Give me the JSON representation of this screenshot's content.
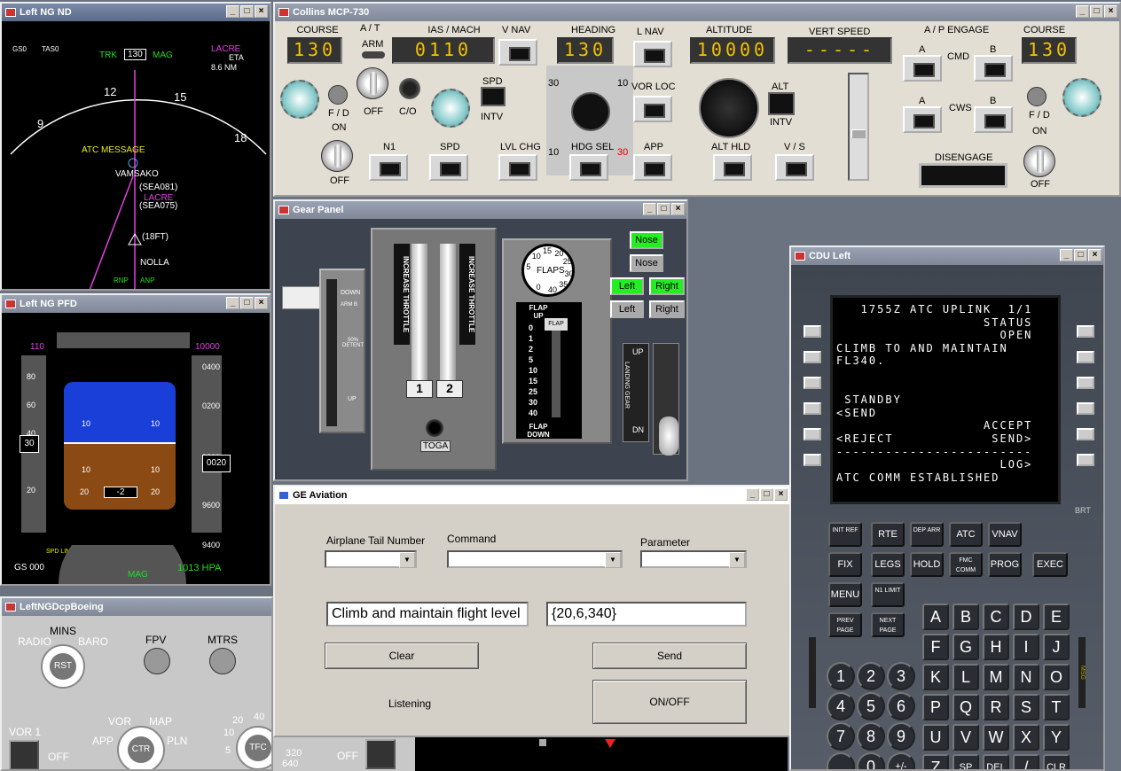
{
  "nd": {
    "title": "Left NG ND",
    "gs": "GS0",
    "tas": "TAS0",
    "trk": "TRK",
    "hdg": "130",
    "mag": "MAG",
    "wpt": "LACRE",
    "eta": "ETA",
    "dist": "8.6 NM",
    "atc_msg": "ATC MESSAGE",
    "fixes": [
      "VAMSAKO",
      "(SEA081)",
      "LACRE",
      "(SEA075)",
      "(18FT)",
      "NOLLA"
    ],
    "scale": [
      "9",
      "12",
      "15",
      "18"
    ],
    "rnp": "RNP",
    "anp": "ANP"
  },
  "pfd": {
    "title": "Left NG PFD",
    "spd_sel": "110",
    "alt_sel": "10000",
    "speeds": [
      "80",
      "60",
      "40",
      "20"
    ],
    "spd_box": "30",
    "alts": [
      "0400",
      "0200",
      "9800",
      "9600",
      "9400"
    ],
    "alt_box": "0020",
    "pitch": [
      "10",
      "10",
      "10",
      "10",
      "20",
      "20"
    ],
    "vs": "-2",
    "gs_readout": "GS 000",
    "spd_lim": "SPD LIM",
    "hdg_mag": "MAG",
    "baro": "1013 HPA"
  },
  "efis": {
    "title": "LeftNGDcpBoeing",
    "mins": "MINS",
    "radio": "RADIO",
    "baro": "BARO",
    "rst": "RST",
    "fpv": "FPV",
    "mtrs": "MTRS",
    "vor1": "VOR 1",
    "off": "OFF",
    "vor": "VOR",
    "map": "MAP",
    "app": "APP",
    "pln": "PLN",
    "ctr": "CTR",
    "tfc": "TFC",
    "ranges": [
      "20",
      "40",
      "10",
      "5",
      "320",
      "640"
    ],
    "off2": "OFF"
  },
  "mcp": {
    "title": "Collins MCP-730",
    "course_l_lbl": "COURSE",
    "course_l": "130",
    "at_lbl": "A / T",
    "arm": "ARM",
    "off": "OFF",
    "ias_lbl": "IAS / MACH",
    "ias": "0110",
    "vnav": "V NAV",
    "heading_lbl": "HEADING",
    "heading": "130",
    "lnav": "L NAV",
    "altitude_lbl": "ALTITUDE",
    "altitude": "10000",
    "vs_lbl": "VERT SPEED",
    "vs": "-----",
    "ap_engage": "A / P ENGAGE",
    "course_r_lbl": "COURSE",
    "course_r": "130",
    "fd": "F / D",
    "on": "ON",
    "co": "C/O",
    "spd": "SPD",
    "intv": "INTV",
    "vorloc": "VOR LOC",
    "alt": "ALT",
    "intv2": "INTV",
    "a": "A",
    "b": "B",
    "cmd": "CMD",
    "cws": "CWS",
    "n1": "N1",
    "spd2": "SPD",
    "lvlchg": "LVL CHG",
    "hdgsel": "HDG SEL",
    "appr": "APP",
    "althld": "ALT HLD",
    "vsbtn": "V / S",
    "disengage": "DISENGAGE",
    "hdg_scale": [
      "30",
      "10",
      "10",
      "30"
    ]
  },
  "gear": {
    "title": "Gear Panel",
    "down": "DOWN",
    "arm": "ARM B",
    "detent": "50% DETENT",
    "up": "UP",
    "inc1": "INCREASE THROTTLE",
    "inc2": "INCREASE THROTTLE",
    "t1": "1",
    "t2": "2",
    "toga": "TOGA",
    "flaps": "FLAPS",
    "flap_up": "FLAP UP",
    "flap_down": "FLAP DOWN",
    "flap_marks": [
      "0",
      "1",
      "2",
      "5",
      "10",
      "15",
      "25",
      "30",
      "40"
    ],
    "flap_handle": "FLAP",
    "nose_on": "Nose",
    "nose_off": "Nose",
    "left_on": "Left",
    "right_on": "Right",
    "left_off": "Left",
    "right_off": "Right",
    "landing": "LANDING GEAR",
    "lg_up": "UP",
    "lg_dn": "DN",
    "dial": [
      "5",
      "10",
      "15",
      "20",
      "25",
      "30",
      "35",
      "40",
      "0"
    ]
  },
  "ge": {
    "title": "GE Aviation",
    "tail_lbl": "Airplane Tail Number",
    "cmd_lbl": "Command",
    "param_lbl": "Parameter",
    "cmd_text": "Climb and maintain flight level",
    "param_text": "{20,6,340}",
    "clear": "Clear",
    "send": "Send",
    "status": "Listening",
    "onoff": "ON/OFF"
  },
  "cdu": {
    "title": "CDU Left",
    "lines": [
      "   1755Z ATC UPLINK  1/1",
      "                  STATUS",
      "                    OPEN",
      "CLIMB TO AND MAINTAIN",
      "FL340.",
      "",
      "",
      " STANDBY",
      "<SEND",
      "                  ACCEPT",
      "<REJECT            SEND>",
      "------------------------",
      "                    LOG>",
      "ATC COMM ESTABLISHED"
    ],
    "brt": "BRT",
    "fkeys": [
      "INIT REF",
      "RTE",
      "DEP ARR",
      "ATC",
      "VNAV",
      "FIX",
      "LEGS",
      "HOLD",
      "FMC COMM",
      "PROG",
      "EXEC",
      "MENU",
      "N1 LIMIT",
      "PREV PAGE",
      "NEXT PAGE"
    ],
    "letters": [
      "A",
      "B",
      "C",
      "D",
      "E",
      "F",
      "G",
      "H",
      "I",
      "J",
      "K",
      "L",
      "M",
      "N",
      "O",
      "P",
      "Q",
      "R",
      "S",
      "T",
      "U",
      "V",
      "W",
      "X",
      "Y",
      "Z",
      "SP",
      "DEL",
      "/",
      "CLR"
    ],
    "digits": [
      "1",
      "2",
      "3",
      "4",
      "5",
      "6",
      "7",
      "8",
      "9",
      ".",
      "0",
      "+/-"
    ],
    "msg": "MSG"
  },
  "colors": {
    "accent_green": "#22dd22",
    "cdu_screen": "#000000",
    "lcd_yellow": "#f5c000",
    "magenta": "#e040e0"
  }
}
